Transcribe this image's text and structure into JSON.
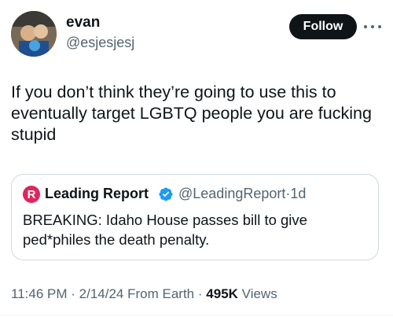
{
  "author": {
    "name": "evan",
    "handle": "@esjesjesj"
  },
  "follow_label": "Follow",
  "more_icon": "more-horizontal-icon",
  "tweet": {
    "text": "If you don’t think they’re going to use this to eventually target LGBTQ people you are fucking stupid"
  },
  "quote": {
    "logo_letter": "R",
    "name": "Leading Report",
    "handle": "@LeadingReport",
    "separator": "·",
    "time": "1d",
    "text": "BREAKING: Idaho House passes bill to give ped*philes the death penalty.",
    "verified_icon": "verified-badge-icon"
  },
  "footer": {
    "time": "11:46 PM",
    "sep1": "·",
    "date": "2/14/24",
    "source": "From Earth",
    "sep2": "·",
    "views_count": "495K",
    "views_label": "Views"
  },
  "colors": {
    "text_primary": "#0f1419",
    "text_secondary": "#536471",
    "verified": "#1d9bf0",
    "logo": "#e0245e",
    "border": "#cfd9de"
  }
}
